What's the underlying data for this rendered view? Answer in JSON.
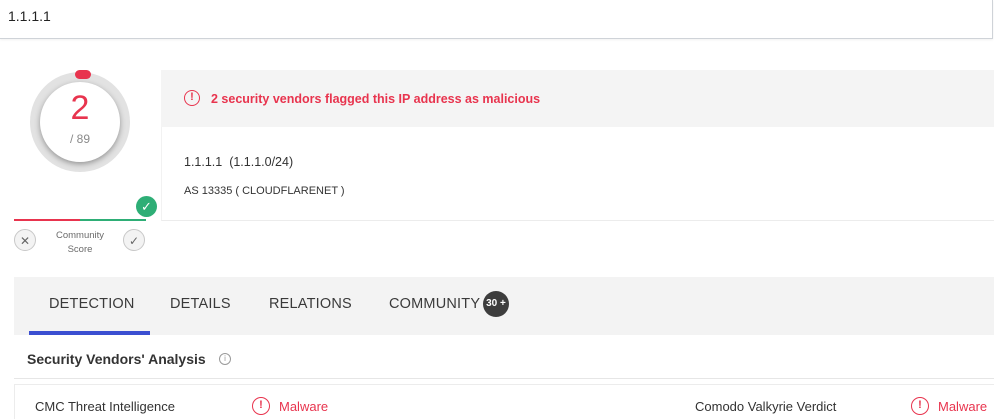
{
  "search": {
    "value": "1.1.1.1"
  },
  "score": {
    "detected": "2",
    "total": "/ 89"
  },
  "community": {
    "label_line1": "Community",
    "label_line2": "Score",
    "downvote_icon": "close-icon",
    "upvote_icon": "check-icon"
  },
  "alert": {
    "text": "2 security vendors flagged this IP address as malicious",
    "icon": "alert-circle-icon"
  },
  "info": {
    "ip": "1.1.1.1",
    "range": "(1.1.1.0/24)",
    "as_line": "AS 13335 ( CLOUDFLARENET )"
  },
  "tabs": [
    {
      "label": "DETECTION",
      "active": true
    },
    {
      "label": "DETAILS",
      "active": false
    },
    {
      "label": "RELATIONS",
      "active": false
    },
    {
      "label": "COMMUNITY",
      "active": false,
      "badge": "30 +"
    }
  ],
  "section": {
    "title": "Security Vendors' Analysis"
  },
  "vendors": [
    {
      "name": "CMC Threat Intelligence",
      "result": "Malware"
    },
    {
      "name": "Comodo Valkyrie Verdict",
      "result": "Malware"
    }
  ],
  "colors": {
    "malicious": "#e8344e",
    "harmless": "#2eae76",
    "accent": "#3b4fd1"
  }
}
